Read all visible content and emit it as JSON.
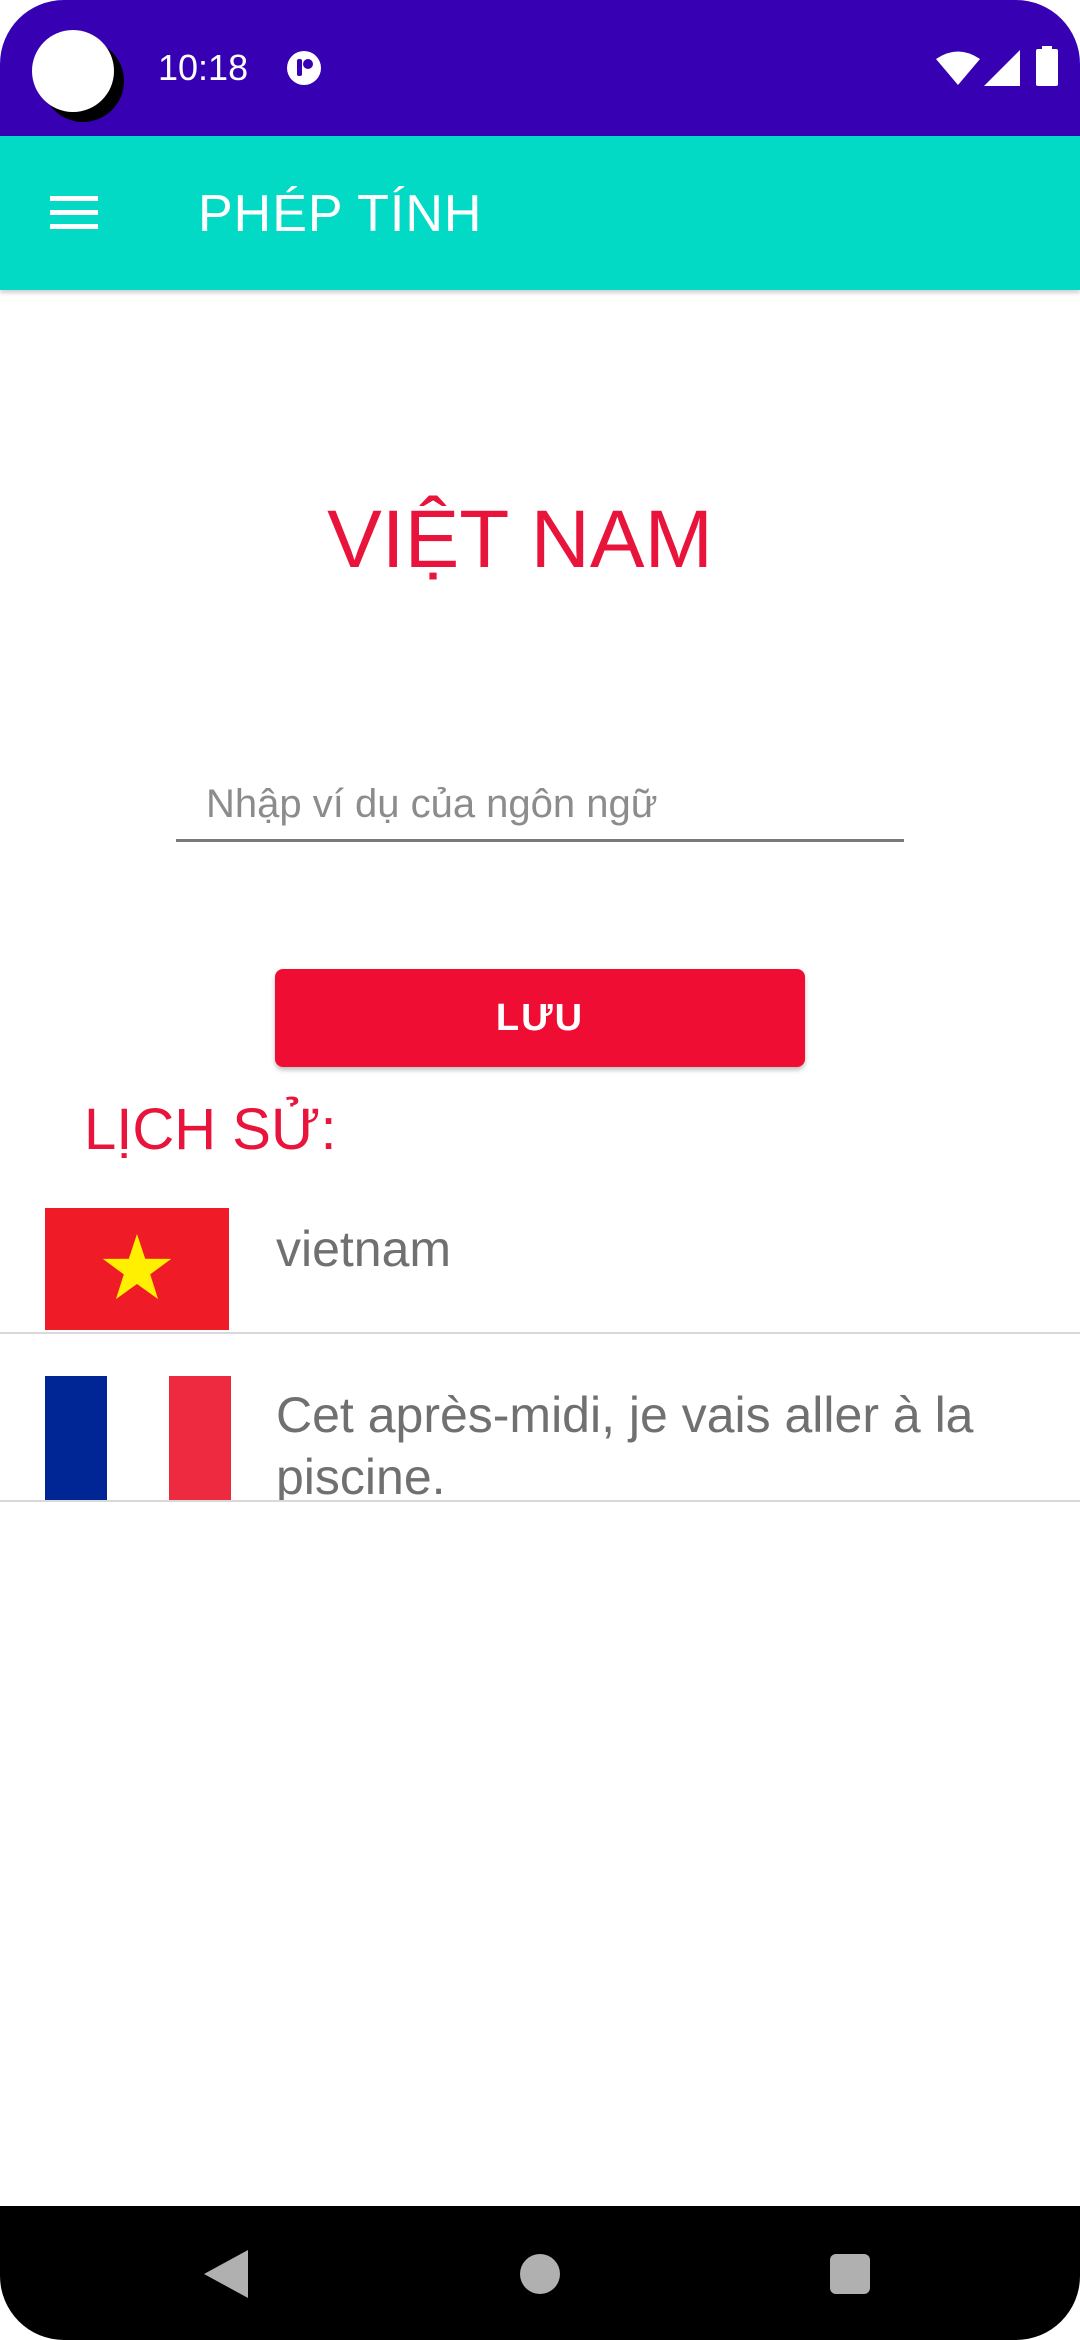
{
  "status_bar": {
    "time": "10:18",
    "icons": [
      "camera-cutout",
      "notification-icon",
      "wifi-icon",
      "signal-icon",
      "battery-icon"
    ]
  },
  "app_bar": {
    "title": "PHÉP TÍNH",
    "menu_icon": "hamburger-menu-icon",
    "background": "#03dac5"
  },
  "main": {
    "country_title": "VIỆT NAM",
    "input": {
      "placeholder": "Nhập ví dụ của ngôn ngữ",
      "value": ""
    },
    "save_label": "LƯU",
    "history_heading": "LỊCH SỬ:"
  },
  "history": [
    {
      "flag": "vietnam-flag",
      "text": "vietnam"
    },
    {
      "flag": "france-flag",
      "text": "Cet après-midi, je vais aller à la piscine."
    }
  ],
  "colors": {
    "status_bar": "#3700b3",
    "accent_red": "#e8143c",
    "button_red": "#ef0d33",
    "flag_vn_red": "#ef1b26",
    "flag_vn_star": "#ffef00",
    "flag_fr_blue": "#002595",
    "flag_fr_white": "#ffffff",
    "flag_fr_red": "#ee2a40"
  },
  "nav_bar": {
    "icons": [
      "back-icon",
      "home-icon",
      "recents-icon"
    ]
  }
}
